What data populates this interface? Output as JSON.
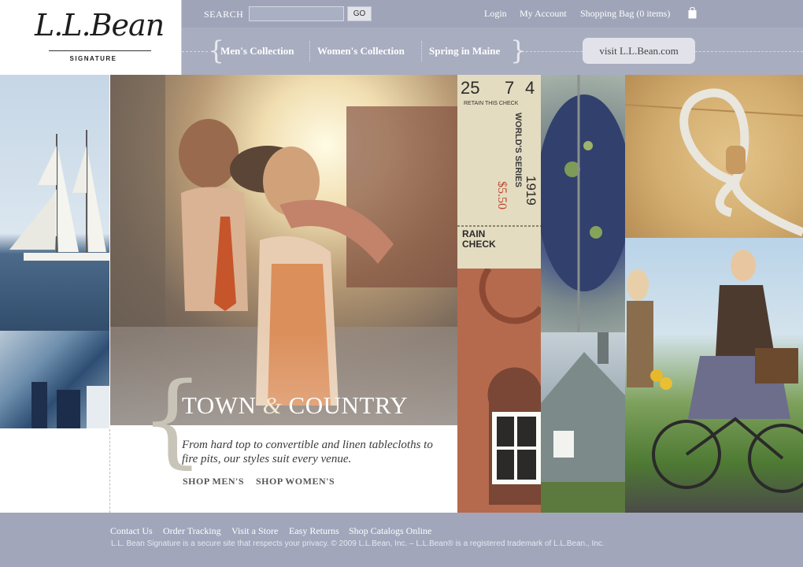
{
  "brand": {
    "script": "L.L.Bean",
    "sub": "SIGNATURE"
  },
  "topbar": {
    "search_label": "SEARCH",
    "search_value": "",
    "go_label": "GO",
    "login": "Login",
    "account": "My Account",
    "bag": "Shopping Bag (0 items)"
  },
  "nav": {
    "items": [
      "Men's Collection",
      "Women's Collection",
      "Spring in Maine"
    ],
    "visit": "visit L.L.Bean.com"
  },
  "promo": {
    "title_a": "TOWN",
    "title_amp": "&",
    "title_b": "COUNTRY",
    "desc": "From hard top to convertible and linen tablecloths to fire pits, our styles suit every venue.",
    "shop_mens": "SHOP MEN'S",
    "shop_womens": "SHOP WOMEN'S"
  },
  "ticket": {
    "num_a": "25",
    "num_b": "7",
    "num_c": "4",
    "retain": "RETAIN THIS CHECK",
    "series": "WORLD'S SERIES",
    "year": "1919",
    "price": "$5.50",
    "rain": "RAIN",
    "check": "CHECK"
  },
  "footer": {
    "links": [
      "Contact Us",
      "Order Tracking",
      "Visit a Store",
      "Easy Returns",
      "Shop Catalogs Online"
    ],
    "legal": "L.L. Bean Signature is a secure site that respects your privacy. © 2009 L.L.Bean, Inc. – L.L.Bean® is a registered trademark of L.L.Bean., Inc."
  },
  "colors": {
    "bar": "#9fa4b9",
    "nav": "#a8adc0",
    "footer": "#a1a6bb"
  }
}
